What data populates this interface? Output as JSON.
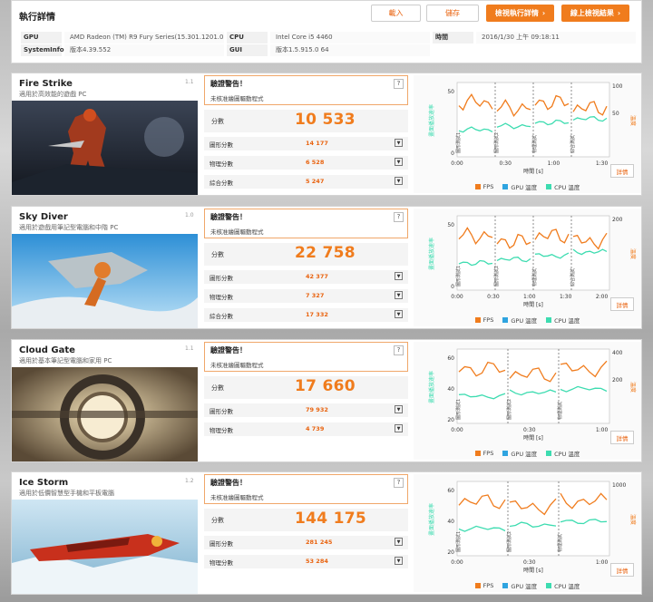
{
  "header": {
    "title": "執行詳情",
    "load_label": "載入",
    "save_label": "儲存",
    "view_label": "檢視執行詳情",
    "online_label": "線上檢視結果"
  },
  "sysinfo": [
    {
      "key": "GPU",
      "value": "AMD Radeon (TM) R9 Fury Series(15.301.1201.0)"
    },
    {
      "key": "SystemInfo",
      "value": "版本4.39.552"
    },
    {
      "key": "CPU",
      "value": "Intel Core i5 4460"
    },
    {
      "key": "GUI",
      "value": "版本1.5.915.0 64"
    },
    {
      "key": "時間",
      "value": "2016/1/30 上午 09:18:11"
    }
  ],
  "common": {
    "warn_title": "驗證警告！",
    "warn_msg": "未核准繪圖驅動程式",
    "help": "?",
    "score_label": "分數",
    "detail": "詳情",
    "time_axis": "時間 [s]",
    "legend": [
      "FPS",
      "GPU 溫度",
      "CPU 溫度"
    ]
  },
  "colors": {
    "fps": "#f07c1d",
    "gpu": "#2fa4e0",
    "cpu": "#3ddcb0",
    "accent": "#f07c1d"
  },
  "tests": [
    {
      "name": "Fire Strike",
      "desc": "適用於高效能的遊戲 PC",
      "version": "1.1",
      "score": "10 533",
      "subs": [
        {
          "label": "圖形分數",
          "value": "14 177"
        },
        {
          "label": "物理分數",
          "value": "6 528"
        },
        {
          "label": "綜合分數",
          "value": "5 247"
        }
      ],
      "chart": {
        "left_axis": "畫面播放速率",
        "right_axis": "溫度",
        "y_left_ticks": [
          "50",
          "0"
        ],
        "y_right_ticks": [
          "100",
          "50"
        ],
        "x_ticks": [
          "0:00",
          "0:30",
          "1:00",
          "1:30"
        ],
        "sections": [
          "圖形測試1",
          "圖形測試2",
          "物理測試",
          "綜合測試"
        ]
      }
    },
    {
      "name": "Sky Diver",
      "desc": "適用於遊戲用筆記型電腦和中階 PC",
      "version": "1.0",
      "score": "22 758",
      "subs": [
        {
          "label": "圖形分數",
          "value": "42 377"
        },
        {
          "label": "物理分數",
          "value": "7 327"
        },
        {
          "label": "綜合分數",
          "value": "17 332"
        }
      ],
      "chart": {
        "left_axis": "畫面播放速率",
        "right_axis": "溫度",
        "y_left_ticks": [
          "50",
          "0"
        ],
        "y_right_ticks": [
          "200"
        ],
        "x_ticks": [
          "0:00",
          "0:30",
          "1:00",
          "1:30",
          "2:00"
        ],
        "sections": [
          "圖形測試1",
          "圖形測試2",
          "物理測試",
          "綜合測試"
        ]
      }
    },
    {
      "name": "Cloud Gate",
      "desc": "適用於基本筆記型電腦和家用 PC",
      "version": "1.1",
      "score": "17 660",
      "subs": [
        {
          "label": "圖形分數",
          "value": "79 932"
        },
        {
          "label": "物理分數",
          "value": "4 739"
        }
      ],
      "chart": {
        "left_axis": "畫面播放速率",
        "right_axis": "溫度",
        "y_left_ticks": [
          "60",
          "40",
          "20"
        ],
        "y_right_ticks": [
          "400",
          "200"
        ],
        "x_ticks": [
          "0:00",
          "0:30",
          "1:00"
        ],
        "sections": [
          "圖形測試1",
          "圖形測試2",
          "物理測試"
        ]
      }
    },
    {
      "name": "Ice Storm",
      "desc": "適用於低價智慧型手機和平板電腦",
      "version": "1.2",
      "score": "144 175",
      "subs": [
        {
          "label": "圖形分數",
          "value": "281 245"
        },
        {
          "label": "物理分數",
          "value": "53 284"
        }
      ],
      "chart": {
        "left_axis": "畫面播放速率",
        "right_axis": "溫度",
        "y_left_ticks": [
          "60",
          "40",
          "20"
        ],
        "y_right_ticks": [
          "1000"
        ],
        "x_ticks": [
          "0:00",
          "0:30",
          "1:00"
        ],
        "sections": [
          "圖形測試1",
          "圖形測試2",
          "物理測試"
        ]
      }
    }
  ]
}
